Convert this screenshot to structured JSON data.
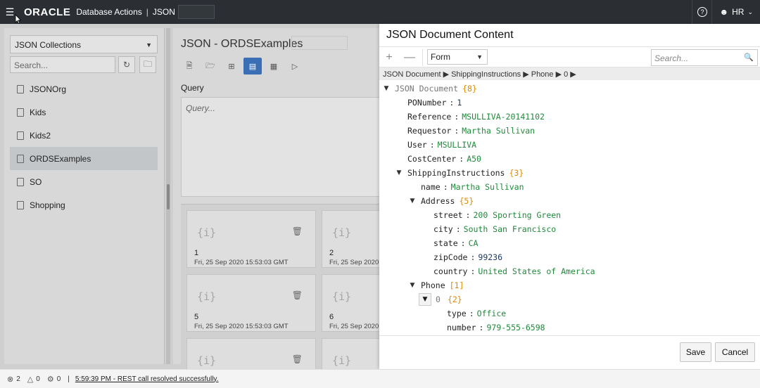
{
  "header": {
    "logo_text": "ORACLE",
    "app_name": "Database Actions",
    "separator": "|",
    "section": "JSON",
    "user": "HR"
  },
  "left_panel": {
    "collection_selector": "JSON Collections",
    "search_placeholder": "Search...",
    "collections": [
      "JSONOrg",
      "Kids",
      "Kids2",
      "ORDSExamples",
      "SO",
      "Shopping"
    ],
    "selected_index": 3
  },
  "middle_panel": {
    "title": "JSON - ORDSExamples",
    "query_label": "Query",
    "query_placeholder": "Query...",
    "cards": [
      {
        "icon_text": "{i}",
        "number": "1",
        "date": "Fri, 25 Sep 2020 15:53:03 GMT"
      },
      {
        "icon_text": "{i}",
        "number": "2",
        "date": "Fri, 25 Sep 2020"
      },
      {
        "icon_text": "{i}",
        "number": "5",
        "date": "Fri, 25 Sep 2020 15:53:03 GMT"
      },
      {
        "icon_text": "{i}",
        "number": "6",
        "date": "Fri, 25 Sep 2020"
      },
      {
        "icon_text": "{i}",
        "number": "",
        "date": ""
      },
      {
        "icon_text": "{i}",
        "number": "",
        "date": ""
      }
    ]
  },
  "right_panel": {
    "title": "JSON Document Content",
    "plus_label": "+",
    "minus_label": "—",
    "mode": "Form",
    "search_placeholder": "Search...",
    "breadcrumb": "JSON Document ▶ ShippingInstructions ▶ Phone ▶ 0 ▶",
    "tree": [
      {
        "toggle": "▼",
        "key": "JSON Document",
        "count": "{8}",
        "type": "root"
      },
      {
        "key": "PONumber",
        "value": "1",
        "vtype": "num"
      },
      {
        "key": "Reference",
        "value": "MSULLIVA-20141102",
        "vtype": "str"
      },
      {
        "key": "Requestor",
        "value": "Martha Sullivan",
        "vtype": "str"
      },
      {
        "key": "User",
        "value": "MSULLIVA",
        "vtype": "str"
      },
      {
        "key": "CostCenter",
        "value": "A50",
        "vtype": "str"
      },
      {
        "toggle": "▼",
        "key": "ShippingInstructions",
        "count": "{3}"
      },
      {
        "key": "name",
        "value": "Martha Sullivan",
        "vtype": "str"
      },
      {
        "toggle": "▼",
        "key": "Address",
        "count": "{5}"
      },
      {
        "key": "street",
        "value": "200 Sporting Green",
        "vtype": "str"
      },
      {
        "key": "city",
        "value": "South San Francisco",
        "vtype": "str"
      },
      {
        "key": "state",
        "value": "CA",
        "vtype": "str"
      },
      {
        "key": "zipCode",
        "value": "99236",
        "vtype": "num"
      },
      {
        "key": "country",
        "value": "United States of America",
        "vtype": "str"
      },
      {
        "toggle": "▼",
        "key": "Phone",
        "count": "[1]"
      },
      {
        "toggle": "▼",
        "key": "0",
        "count": "{2}",
        "type": "idx"
      },
      {
        "key": "type",
        "value": "Office",
        "vtype": "str"
      },
      {
        "key": "number",
        "value": "979-555-6598",
        "vtype": "str"
      }
    ],
    "save_label": "Save",
    "cancel_label": "Cancel"
  },
  "status_bar": {
    "errors": "2",
    "warnings": "0",
    "tasks": "0",
    "separator": "|",
    "message": "5:59:39 PM - REST call resolved successfully."
  }
}
